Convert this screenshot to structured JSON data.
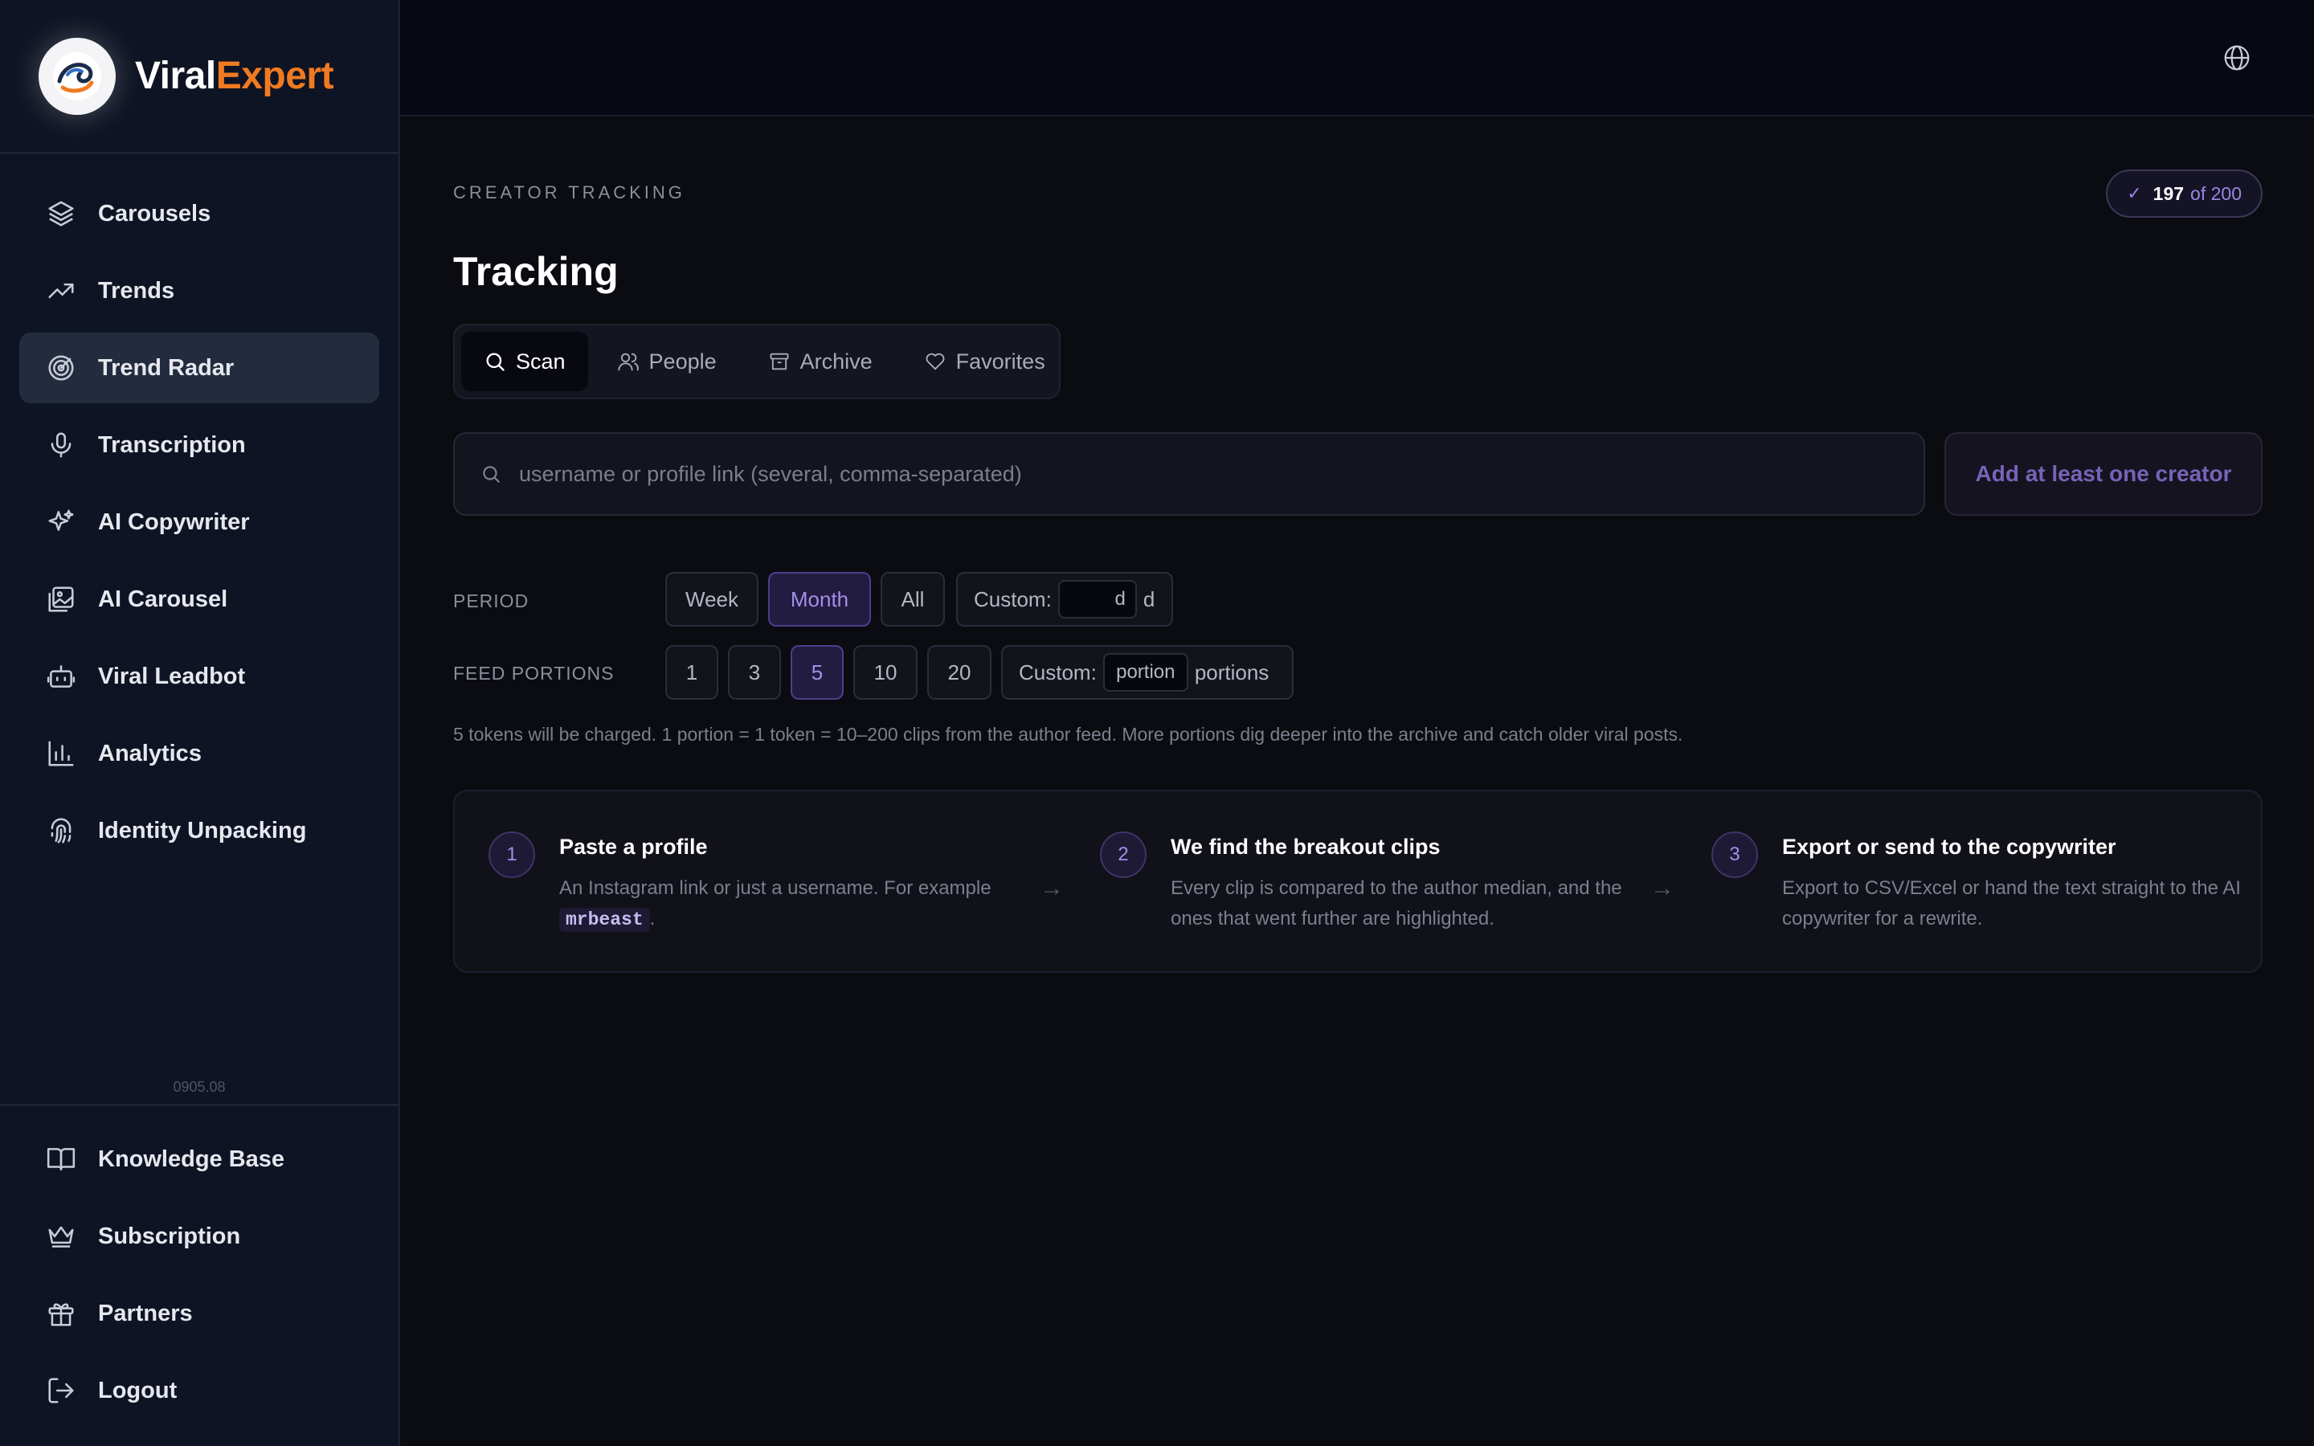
{
  "brand": {
    "name_part1": "Viral",
    "name_part2": "Expert"
  },
  "sidebar": {
    "items": [
      {
        "label": "Carousels",
        "icon": "layers-icon"
      },
      {
        "label": "Trends",
        "icon": "trending-up-icon"
      },
      {
        "label": "Trend Radar",
        "icon": "radar-icon",
        "active": true
      },
      {
        "label": "Transcription",
        "icon": "microphone-icon"
      },
      {
        "label": "AI Copywriter",
        "icon": "sparkles-icon"
      },
      {
        "label": "AI Carousel",
        "icon": "image-stack-icon"
      },
      {
        "label": "Viral Leadbot",
        "icon": "bot-icon"
      },
      {
        "label": "Analytics",
        "icon": "bar-chart-icon"
      },
      {
        "label": "Identity Unpacking",
        "icon": "fingerprint-icon"
      }
    ],
    "version": "0905.08",
    "bottom_items": [
      {
        "label": "Knowledge Base",
        "icon": "book-icon"
      },
      {
        "label": "Subscription",
        "icon": "crown-icon"
      },
      {
        "label": "Partners",
        "icon": "gift-icon"
      },
      {
        "label": "Logout",
        "icon": "logout-icon"
      }
    ]
  },
  "header": {
    "eyebrow": "CREATOR TRACKING",
    "title": "Tracking",
    "quota": {
      "used": "197",
      "of": "of 200"
    }
  },
  "tabs": [
    {
      "label": "Scan",
      "active": true
    },
    {
      "label": "People"
    },
    {
      "label": "Archive"
    },
    {
      "label": "Favorites"
    }
  ],
  "search": {
    "placeholder": "username or profile link (several, comma-separated)",
    "value": "",
    "submit_label": "Add at least one creator"
  },
  "period": {
    "label": "PERIOD",
    "options": [
      "Week",
      "Month",
      "All"
    ],
    "selected": "Month",
    "custom_label": "Custom:",
    "custom_input": "d",
    "custom_unit": "d"
  },
  "feed": {
    "label": "FEED PORTIONS",
    "options": [
      "1",
      "3",
      "5",
      "10",
      "20"
    ],
    "selected": "5",
    "custom_label": "Custom:",
    "custom_input": "portion",
    "custom_unit": "portions"
  },
  "note": "5 tokens will be charged. 1 portion = 1 token = 10–200 clips from the author feed. More portions dig deeper into the archive and catch older viral posts.",
  "steps": [
    {
      "num": "1",
      "title": "Paste a profile",
      "text_before": "An Instagram link or just a username. For example ",
      "code": "mrbeast",
      "text_after": "."
    },
    {
      "num": "2",
      "title": "We find the breakout clips",
      "text": "Every clip is compared to the author median, and the ones that went further are highlighted."
    },
    {
      "num": "3",
      "title": "Export or send to the copywriter",
      "text": "Export to CSV/Excel or hand the text straight to the AI copywriter for a rewrite."
    }
  ],
  "colors": {
    "accent": "#a48de8",
    "brand_orange": "#f07a22",
    "sidebar_bg": "#0f1424"
  }
}
